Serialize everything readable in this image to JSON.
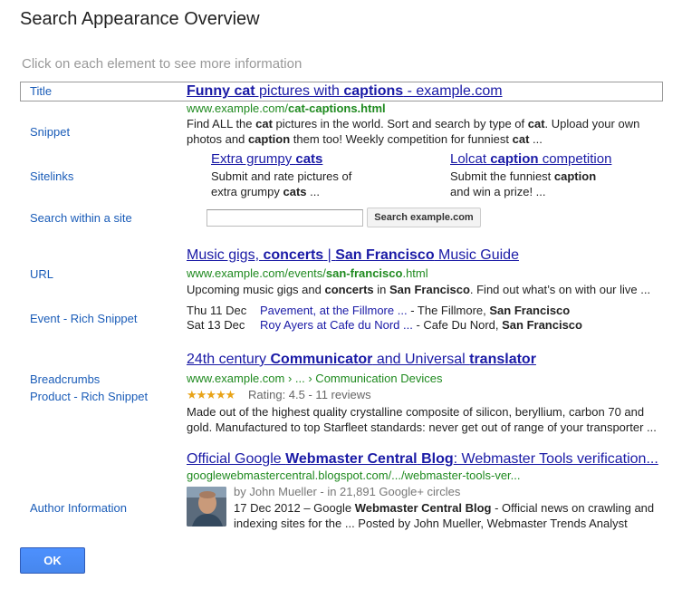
{
  "dialog_title": "Search Appearance Overview",
  "hint": "Click on each element to see more information",
  "labels": {
    "title": "Title",
    "snippet": "Snippet",
    "sitelinks": "Sitelinks",
    "search_within": "Search within a site",
    "url": "URL",
    "event": "Event - Rich Snippet",
    "breadcrumbs": "Breadcrumbs",
    "product": "Product - Rich Snippet",
    "author": "Author Information"
  },
  "result1": {
    "title_a": "Funny cat",
    "title_b": " pictures with ",
    "title_c": "captions",
    "title_d": " - example.com",
    "url_a": "www.example.com/",
    "url_b": "cat-captions.html",
    "snip1_a": "Find ALL the ",
    "snip1_b": "cat",
    "snip1_c": " pictures in the world. Sort and search by type of ",
    "snip1_d": "cat",
    "snip1_e": ". Upload your own",
    "snip2_a": "photos and ",
    "snip2_b": "caption",
    "snip2_c": " them too! Weekly competition for funniest ",
    "snip2_d": "cat",
    "snip2_e": " ..."
  },
  "sitelinks": [
    {
      "title_a": "Extra grumpy ",
      "title_b": "cats",
      "title_c": "",
      "desc1_a": "Submit and rate pictures of",
      "desc1_b": "",
      "desc2_a": "extra grumpy ",
      "desc2_b": "cats",
      "desc2_c": " ..."
    },
    {
      "title_a": "Lolcat ",
      "title_b": "caption",
      "title_c": " competition",
      "desc1_a": "Submit the funniest ",
      "desc1_b": "caption",
      "desc2_a": "and win a prize! ...",
      "desc2_b": "",
      "desc2_c": ""
    }
  ],
  "search_within": {
    "button": "Search example.com",
    "value": ""
  },
  "result2": {
    "title_a": "Music gigs, ",
    "title_b": "concerts",
    "title_c": " | ",
    "title_d": "San Francisco",
    "title_e": " Music Guide",
    "url_a": "www.example.com/events/",
    "url_b": "san-francisco",
    "url_c": ".html",
    "snip_a": "Upcoming music gigs and ",
    "snip_b": "concerts",
    "snip_c": " in ",
    "snip_d": "San Francisco",
    "snip_e": ". Find out what’s on with our live ...",
    "events": [
      {
        "date": "Thu 11 Dec",
        "link": "Pavement, at the Fillmore ...",
        "venue": " - The Fillmore, ",
        "city": "San Francisco"
      },
      {
        "date": "Sat 13 Dec",
        "link": "Roy Ayers at Cafe du Nord ...",
        "venue": " - Cafe Du Nord, ",
        "city": "San Francisco"
      }
    ]
  },
  "result3": {
    "title_a": "24th century ",
    "title_b": "Communicator",
    "title_c": " and Universal ",
    "title_d": "translator",
    "breadcrumb": "www.example.com › ... › Communication Devices",
    "stars": "★★★★★",
    "rating": 4.5,
    "rating_text": "Rating: 4.5 - 11 reviews",
    "snip1": "Made out of the highest quality crystalline composite of silicon, beryllium, carbon 70 and",
    "snip2": "gold. Manufactured to top Starfleet standards: never get out of range of your transporter ..."
  },
  "result4": {
    "title_a": "Official Google ",
    "title_b": "Webmaster Central",
    "title_c": " ",
    "title_d": "Blog",
    "title_e": ": Webmaster Tools verification...",
    "url": "googlewebmastercentral.blogspot.com/.../webmaster-tools-ver...",
    "author": "by John Mueller - in 21,891 Google+ circles",
    "snip1_a": "17 Dec 2012 – Google ",
    "snip1_b": "Webmaster Central Blog",
    "snip1_c": " - Official news on crawling and",
    "snip2": "indexing  sites for the ... Posted by John Mueller, Webmaster Trends Analyst"
  },
  "ok_button": "OK",
  "colors": {
    "link": "#1a1aa6",
    "url": "#1f8a1f",
    "label": "#1a5cb8",
    "star": "#e8a317",
    "ok": "#4d90fe"
  }
}
